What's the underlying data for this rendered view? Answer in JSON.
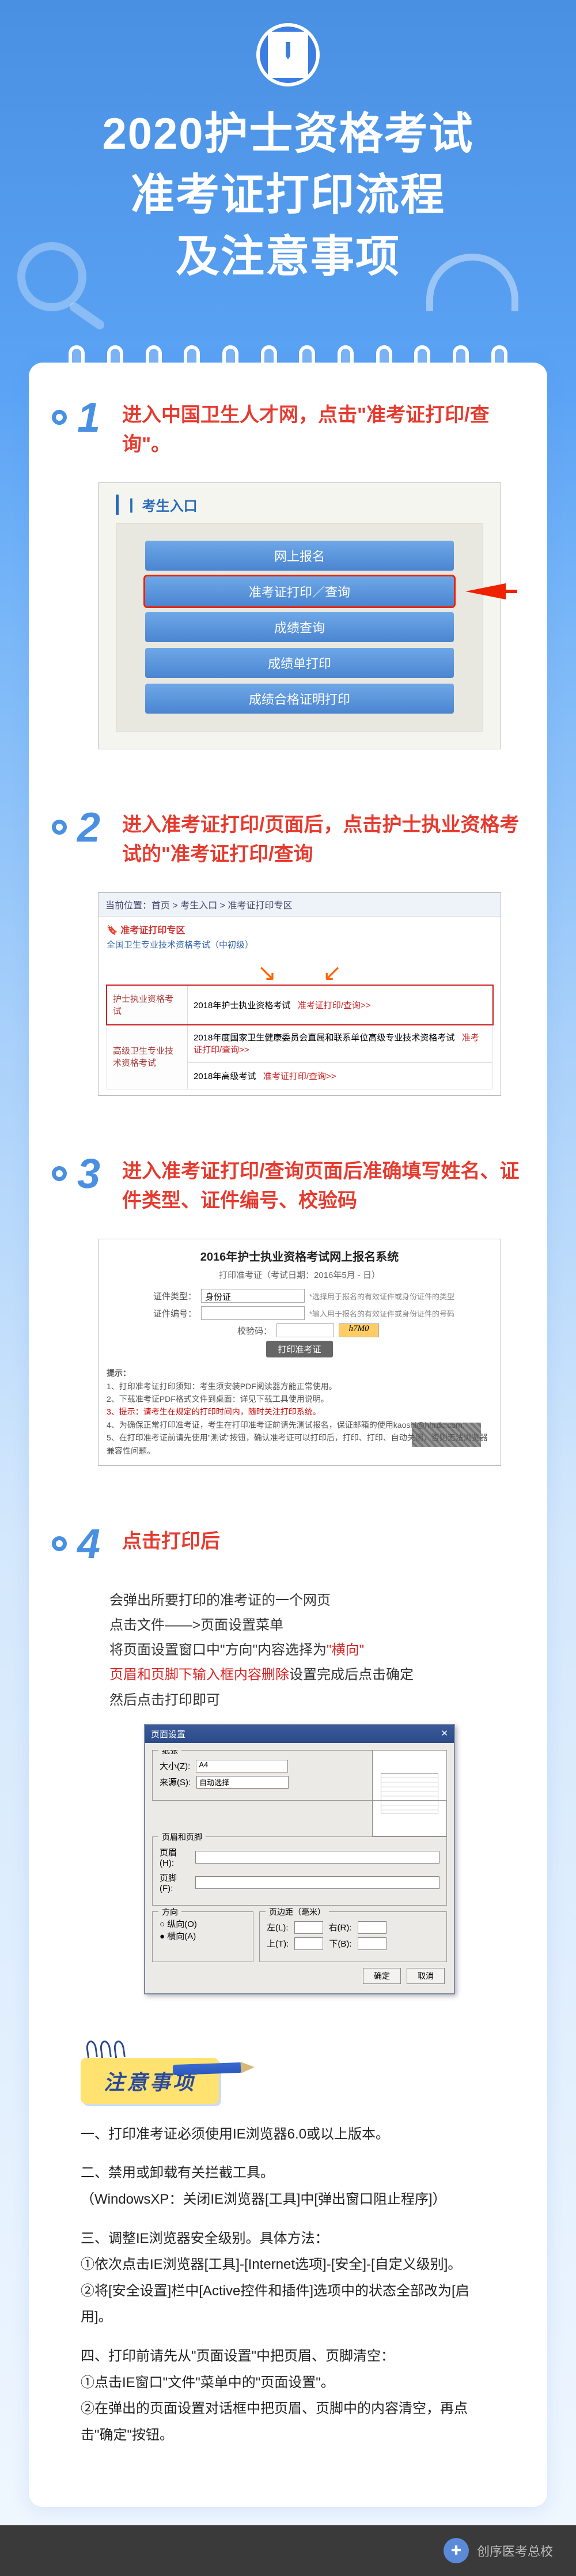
{
  "header": {
    "line1": "2020护士资格考试",
    "line2": "准考证打印流程",
    "line3": "及注意事项"
  },
  "steps": [
    {
      "num": "1",
      "title": "进入中国卫生人才网，点击\"准考证打印/查询\"。",
      "shot1": {
        "heading": "┃ 考生入口",
        "btns": [
          "网上报名",
          "准考证打印／查询",
          "成绩查询",
          "成绩单打印",
          "成绩合格证明打印"
        ],
        "highlight_index": 1
      }
    },
    {
      "num": "2",
      "title": "进入准考证打印/页面后，点击护士执业资格考试的\"准考证打印/查询",
      "shot2": {
        "crumb": "当前位置：首页 > 考生入口 > 准考证打印专区",
        "badge": "准考证打印专区",
        "group_title": "全国卫生专业技术资格考试（中初级）",
        "row1_label": "护士执业资格考试",
        "row1_text": "2018年护士执业资格考试",
        "row1_link": "准考证打印/查询>>",
        "row2_label": "高级卫生专业技术资格考试",
        "row2_text": "2018年度国家卫生健康委员会直属和联系单位高级专业技术资格考试",
        "row2_link": "准考证打印/查询>>",
        "row3_text": "2018年高级考试",
        "row3_link": "准考证打印/查询>>"
      }
    },
    {
      "num": "3",
      "title": "进入准考证打印/查询页面后准确填写姓名、证件类型、证件编号、校验码",
      "shot3": {
        "title": "2016年护士执业资格考试网上报名系统",
        "sub": "打印准考证（考试日期：2016年5月 - 日）",
        "labels": {
          "type": "证件类型：",
          "id": "证件编号：",
          "code": "校验码："
        },
        "type_value": "身份证",
        "btn": "打印准考证",
        "notes_title": "提示：",
        "notes": [
          "1、打印准考证打印须知：考生须安装PDF阅读器方能正常使用。",
          "2、下载准考证PDF格式文件到桌面：详见下载工具使用说明。",
          "3、提示：请考生在规定的打印时间内，随时关注打印系统。",
          "4、为确保正常打印准考证，考生在打印准考证前请先测试报名，保证邮箱的使用kaoshi@hhrdc.com;",
          "5、在打印准考证前请先使用\"测试\"按钮，确认准考证可以打印后，打印、打印、自动关闭，否则无法浏览器兼容性问题。"
        ],
        "red_index": 2
      }
    },
    {
      "num": "4",
      "title": "点击打印后",
      "body": {
        "l1": "会弹出所要打印的准考证的一个网页",
        "l2": "点击文件——>页面设置菜单",
        "l3a": "将页面设置窗口中\"方向\"内容选择为",
        "l3b": "\"横向\"",
        "l4a": "页眉和页脚下输入框内容删除",
        "l4b": "设置完成后点击确定",
        "l5": "然后点击打印即可",
        "dialog": {
          "title": "页面设置",
          "close": "✕",
          "g_paper": "纸张",
          "size_label": "大小(Z):",
          "size_value": "A4",
          "source_label": "来源(S):",
          "source_value": "自动选择",
          "g_hf": "页眉和页脚",
          "header_label": "页眉(H):",
          "footer_label": "页脚(F):",
          "g_orient": "方向",
          "portrait": "○ 纵向(O)",
          "landscape": "● 横向(A)",
          "g_margin": "页边距（毫米）",
          "ml": "左(L):",
          "mr": "右(R):",
          "mt": "上(T):",
          "mb": "下(B):",
          "ok": "确定",
          "cancel": "取消"
        }
      }
    }
  ],
  "attention": {
    "tag": "注意事项",
    "items": [
      "一、打印准考证必须使用IE浏览器6.0或以上版本。",
      "二、禁用或卸载有关拦截工具。\n（WindowsXP：关闭IE浏览器[工具]中[弹出窗口阻止程序]）",
      "三、调整IE浏览器安全级别。具体方法：\n①依次点击IE浏览器[工具]-[Internet选项]-[安全]-[自定义级别]。\n②将[安全设置]栏中[Active控件和插件]选项中的状态全部改为[启用]。",
      "四、打印前请先从\"页面设置\"中把页眉、页脚清空：\n①点击IE窗口\"文件\"菜单中的\"页面设置\"。\n②在弹出的页面设置对话框中把页眉、页脚中的内容清空，再点击\"确定\"按钮。"
    ]
  },
  "footer": {
    "brand": "创序医考总校"
  }
}
